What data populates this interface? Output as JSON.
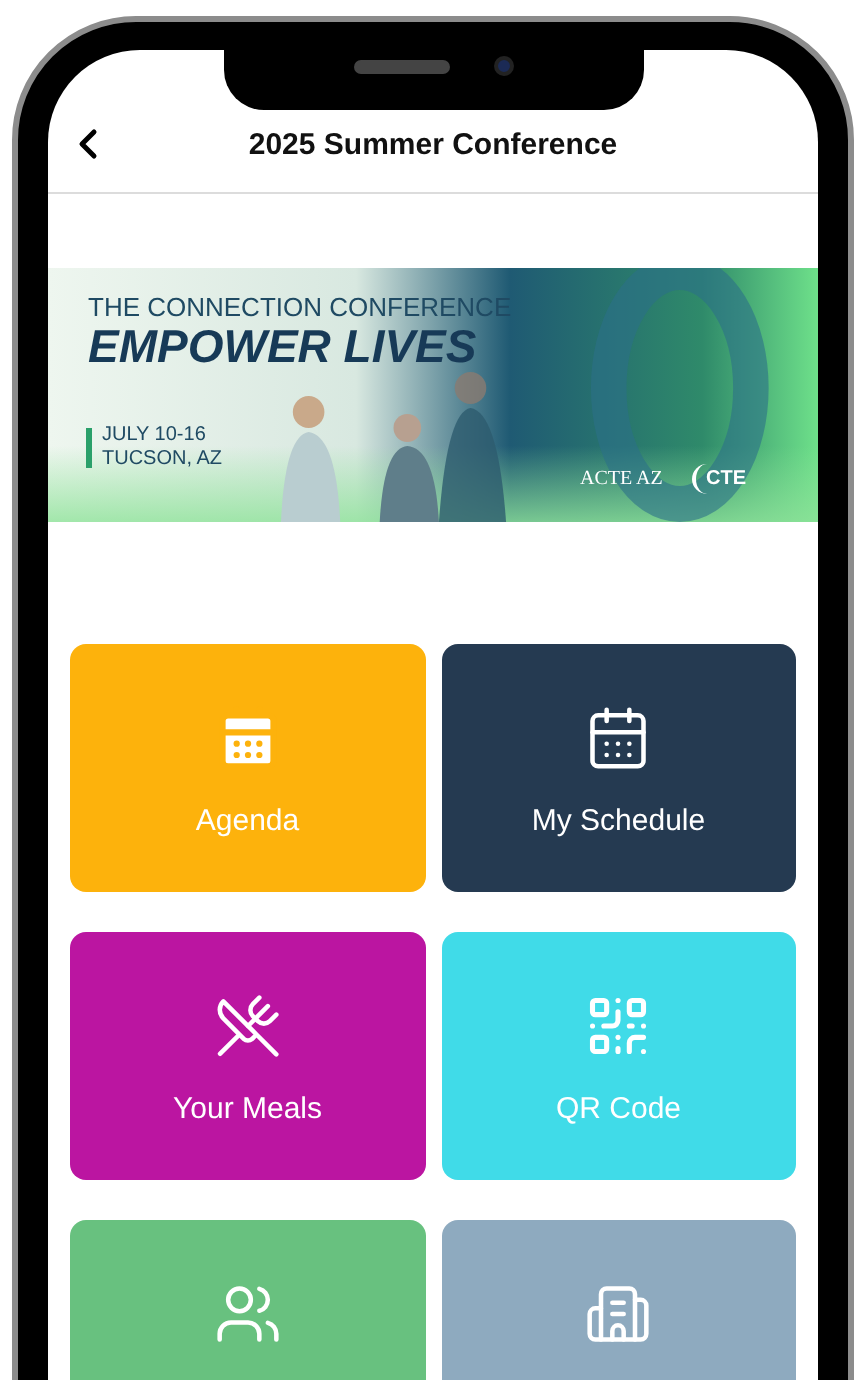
{
  "header": {
    "title": "2025 Summer Conference"
  },
  "banner": {
    "kind": "picture",
    "subtitle": "THE CONNECTION CONFERENCE",
    "headline": "EMPOWER LIVES",
    "dates": "JULY 10-16",
    "location": "TUCSON, AZ",
    "logo_1": "ACTE AZ",
    "logo_2": "CTE"
  },
  "tiles": [
    {
      "label": "Agenda",
      "kind": "calendar-filled",
      "color": "#fdb20c"
    },
    {
      "label": "My Schedule",
      "kind": "calendar",
      "color": "#253a51"
    },
    {
      "label": "Your Meals",
      "kind": "meals",
      "color": "#bb15a1"
    },
    {
      "label": "QR Code",
      "kind": "qr",
      "color": "#40dbe8"
    },
    {
      "kind": "people",
      "color": "#68c17f"
    },
    {
      "kind": "building",
      "color": "#8eaabf"
    }
  ]
}
